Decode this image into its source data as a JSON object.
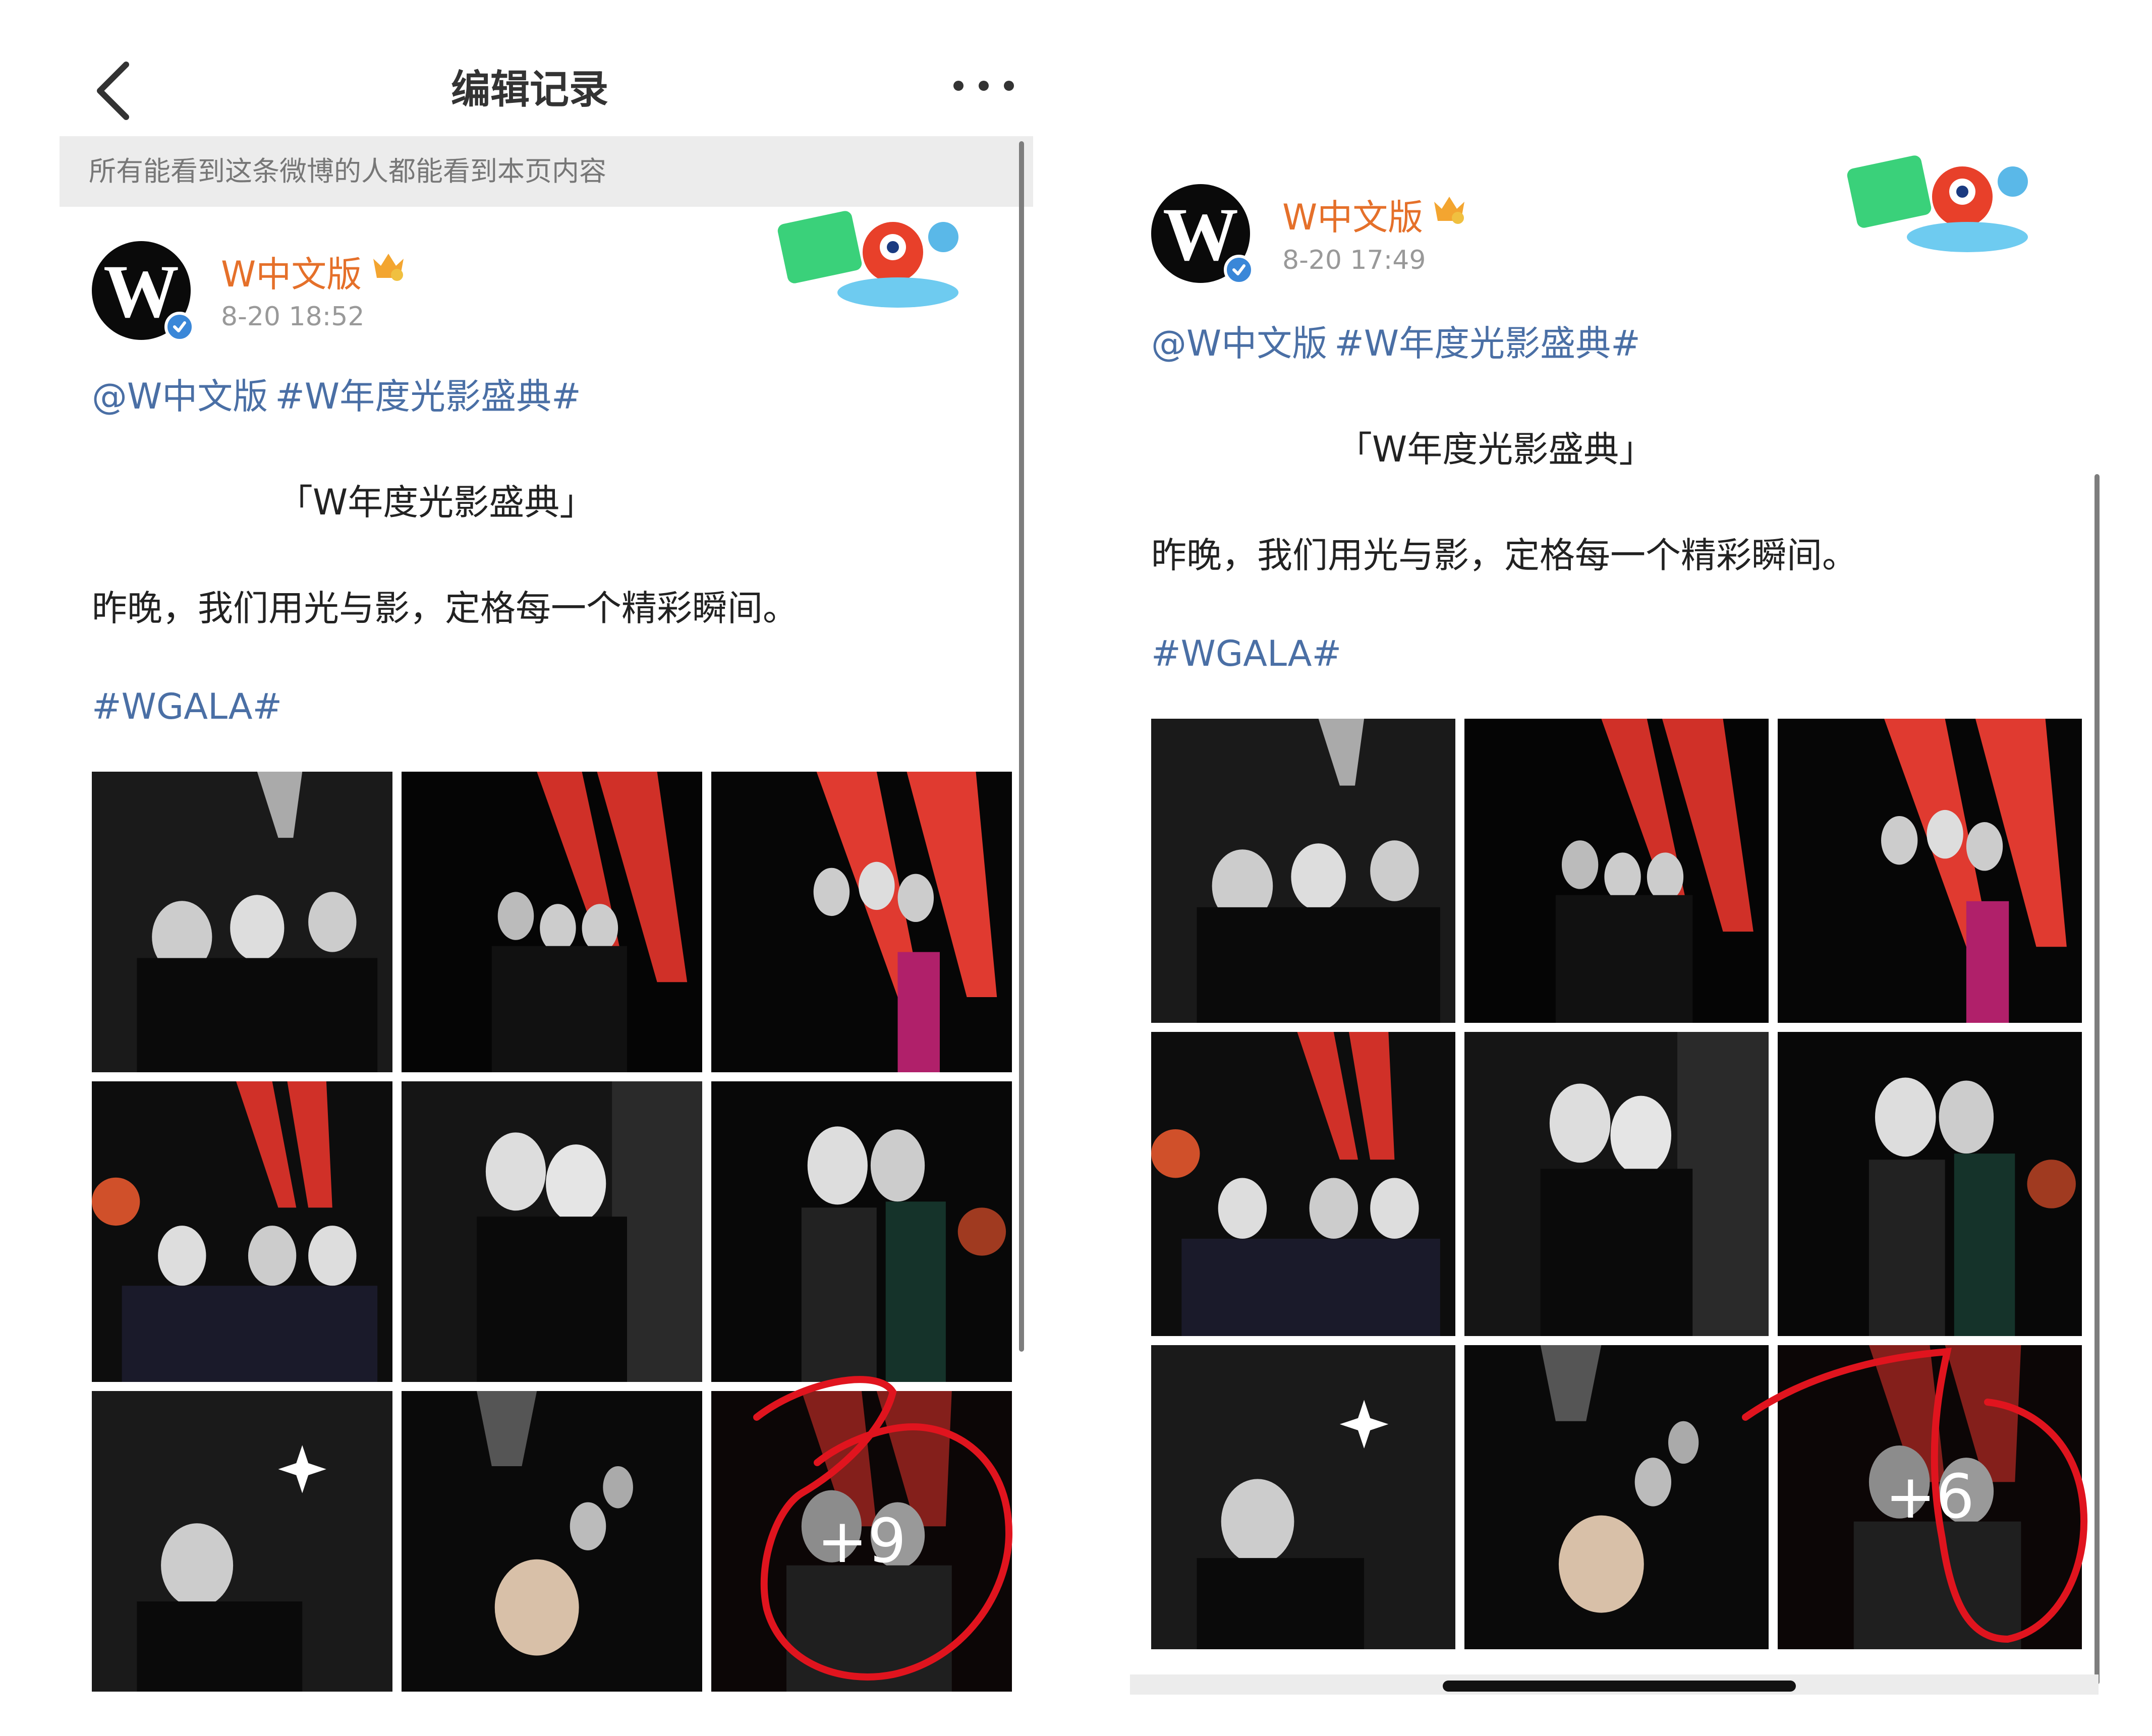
{
  "left": {
    "header": {
      "title": "编辑记录",
      "back_icon": "chevron-left-icon",
      "more_icon": "more-dots-icon"
    },
    "notice": "所有能看到这条微博的人都能看到本页内容",
    "post": {
      "username": "W中文版",
      "timestamp": "8-20 18:52",
      "mention_user": "@W中文版",
      "mention_tag": "#W年度光影盛典#",
      "quote": "「W年度光影盛典」",
      "body": "昨晚，我们用光与影，定格每一个精彩瞬间。",
      "tag": "#WGALA#",
      "more_photos": "+9"
    }
  },
  "right": {
    "post": {
      "username": "W中文版",
      "timestamp": "8-20 17:49",
      "mention_user": "@W中文版",
      "mention_tag": "#W年度光影盛典#",
      "quote": "「W年度光影盛典」",
      "body": "昨晚，我们用光与影，定格每一个精彩瞬间。",
      "tag": "#WGALA#",
      "more_photos": "+6"
    }
  },
  "icons": {
    "avatar_logo": "w-logo-icon",
    "verified": "verified-badge-icon",
    "crown": "vip-crown-icon",
    "sticker": "national-day-sticker-icon"
  },
  "colors": {
    "username": "#e5702a",
    "link": "#4a6fa5",
    "verified": "#3a87d8",
    "annotation": "#e0141e"
  }
}
